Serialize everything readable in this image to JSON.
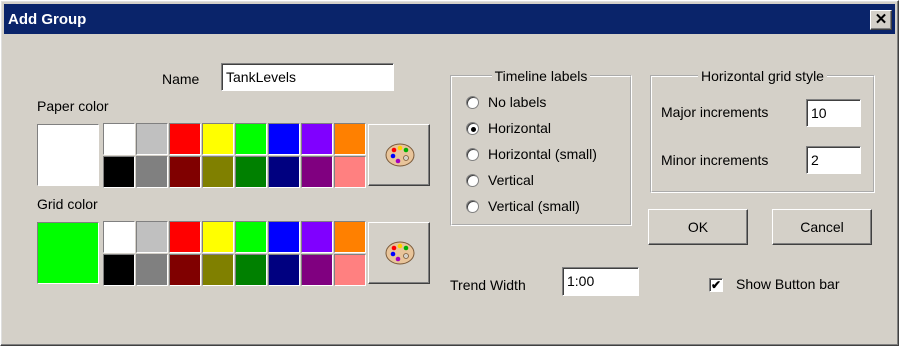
{
  "window": {
    "title": "Add Group",
    "close_glyph": "✕"
  },
  "name": {
    "label": "Name",
    "value": "TankLevels"
  },
  "paper": {
    "label": "Paper color",
    "current": "#ffffff",
    "row1": [
      "#ffffff",
      "#c0c0c0",
      "#ff0000",
      "#ffff00",
      "#00ff00",
      "#0000ff",
      "#8000ff",
      "#ff8000"
    ],
    "row2": [
      "#000000",
      "#808080",
      "#800000",
      "#808000",
      "#008000",
      "#000080",
      "#800080",
      "#ff8080"
    ]
  },
  "grid_color": {
    "label": "Grid color",
    "current": "#00ff00",
    "row1": [
      "#ffffff",
      "#c0c0c0",
      "#ff0000",
      "#ffff00",
      "#00ff00",
      "#0000ff",
      "#8000ff",
      "#ff8000"
    ],
    "row2": [
      "#000000",
      "#808080",
      "#800000",
      "#808000",
      "#008000",
      "#000080",
      "#800080",
      "#ff8080"
    ]
  },
  "timeline": {
    "title": "Timeline labels",
    "options": [
      "No labels",
      "Horizontal",
      "Horizontal (small)",
      "Vertical",
      "Vertical (small)"
    ],
    "selected": "Horizontal"
  },
  "hgrid": {
    "title": "Horizontal grid style",
    "major_label": "Major increments",
    "major_value": "10",
    "minor_label": "Minor increments",
    "minor_value": "2"
  },
  "buttons": {
    "ok": "OK",
    "cancel": "Cancel"
  },
  "trend": {
    "label": "Trend Width",
    "value": "1:00"
  },
  "show_button_bar": {
    "label": "Show Button bar",
    "checked": true,
    "check_glyph": "✔"
  }
}
